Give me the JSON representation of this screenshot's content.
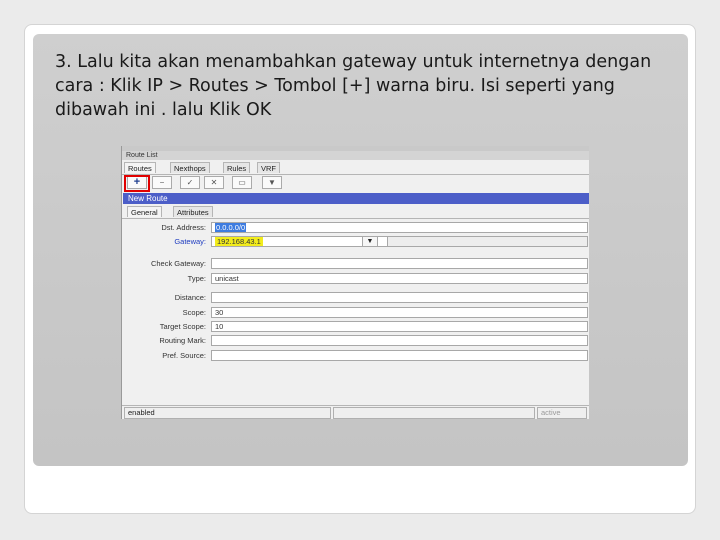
{
  "instruction": "3. Lalu kita akan menambahkan gateway untuk internetnya dengan cara : Klik IP > Routes > Tombol [+] warna biru.  Isi seperti yang dibawah ini . lalu Klik OK",
  "screenshot": {
    "window_title": "Route List",
    "tabs": [
      "Routes",
      "Nexthops",
      "Rules",
      "VRF"
    ],
    "toolbar": {
      "add": "+",
      "remove": "−",
      "enable": "✓",
      "disable": "✕",
      "comment": "▭",
      "filter": "▼"
    },
    "dialog_title": "New Route",
    "dialog_tabs": [
      "General",
      "Attributes"
    ],
    "fields": {
      "dst_address": {
        "label": "Dst. Address:",
        "value": "0.0.0.0/0"
      },
      "gateway": {
        "label": "Gateway:",
        "value": "192.168.43.1"
      },
      "check_gateway": {
        "label": "Check Gateway:",
        "value": ""
      },
      "type": {
        "label": "Type:",
        "value": "unicast"
      },
      "distance": {
        "label": "Distance:",
        "value": ""
      },
      "scope": {
        "label": "Scope:",
        "value": "30"
      },
      "target_scope": {
        "label": "Target Scope:",
        "value": "10"
      },
      "routing_mark": {
        "label": "Routing Mark:",
        "value": ""
      },
      "pref_source": {
        "label": "Pref. Source:",
        "value": ""
      }
    },
    "gateway_dropdown": "▼",
    "status": {
      "state": "enabled",
      "active": "active"
    },
    "colors": {
      "highlight_border": "#e00000",
      "dialog_title_bg": "#4c5ec8",
      "gateway_highlight": "#f2ec1c"
    }
  }
}
